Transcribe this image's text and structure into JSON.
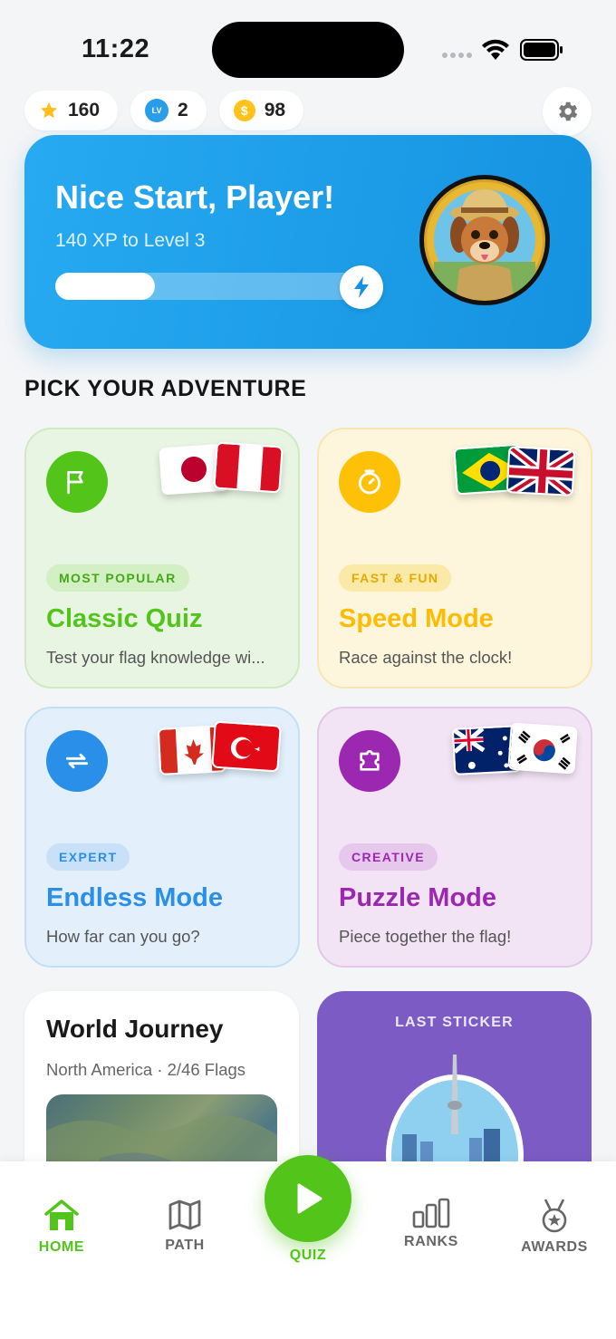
{
  "status_bar": {
    "time": "11:22"
  },
  "stats": {
    "stars": "160",
    "level": "2",
    "level_badge": "LV",
    "coins": "98",
    "coin_symbol": "$"
  },
  "hero": {
    "title": "Nice Start, Player!",
    "subtitle": "140 XP to Level 3",
    "xp_progress": 0.33,
    "accent_color": "#1592e0"
  },
  "section_title": "PICK YOUR ADVENTURE",
  "modes": [
    {
      "tag": "MOST POPULAR",
      "title": "Classic Quiz",
      "description": "Test your flag knowledge wi...",
      "color": "#52c41a",
      "icon": "flag-icon",
      "flags": [
        "Japan",
        "Peru"
      ]
    },
    {
      "tag": "FAST & FUN",
      "title": "Speed Mode",
      "description": "Race against the clock!",
      "color": "#ffc107",
      "icon": "timer-icon",
      "flags": [
        "Brazil",
        "United Kingdom"
      ]
    },
    {
      "tag": "EXPERT",
      "title": "Endless Mode",
      "description": "How far can you go?",
      "color": "#2a8fe8",
      "icon": "repeat-icon",
      "flags": [
        "Canada",
        "Turkey"
      ]
    },
    {
      "tag": "CREATIVE",
      "title": "Puzzle Mode",
      "description": "Piece together the flag!",
      "color": "#9c27b0",
      "icon": "puzzle-icon",
      "flags": [
        "Australia",
        "South Korea"
      ]
    }
  ],
  "journey": {
    "title": "World Journey",
    "subtitle": "North America · 2/46 Flags"
  },
  "sticker": {
    "label": "LAST STICKER"
  },
  "tabs": [
    {
      "label": "HOME",
      "icon": "home-icon",
      "active": true
    },
    {
      "label": "PATH",
      "icon": "map-icon"
    },
    {
      "label": "QUIZ",
      "icon": "play-icon"
    },
    {
      "label": "RANKS",
      "icon": "bar-chart-icon"
    },
    {
      "label": "AWARDS",
      "icon": "medal-icon"
    }
  ]
}
